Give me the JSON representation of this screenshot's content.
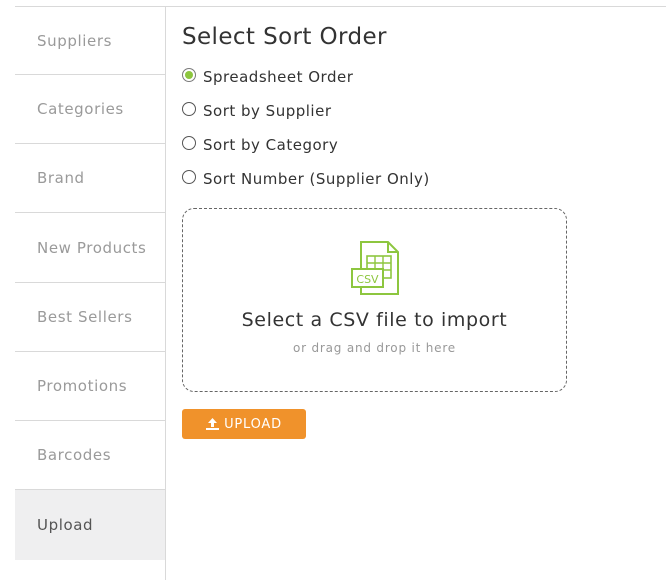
{
  "sidebar": {
    "items": [
      {
        "label": "Suppliers"
      },
      {
        "label": "Categories"
      },
      {
        "label": "Brand"
      },
      {
        "label": "New Products"
      },
      {
        "label": "Best Sellers"
      },
      {
        "label": "Promotions"
      },
      {
        "label": "Barcodes"
      },
      {
        "label": "Upload",
        "active": true
      }
    ]
  },
  "sort": {
    "title": "Select Sort Order",
    "options": [
      {
        "label": "Spreadsheet Order",
        "checked": true
      },
      {
        "label": "Sort by Supplier",
        "checked": false
      },
      {
        "label": "Sort by Category",
        "checked": false
      },
      {
        "label": "Sort Number (Supplier Only)",
        "checked": false
      }
    ]
  },
  "dropzone": {
    "icon": "csv-file-icon",
    "icon_text": "CSV",
    "title": "Select a CSV file to import",
    "subtitle": "or drag and drop it here"
  },
  "upload_button": {
    "label": "UPLOAD",
    "icon": "upload-icon"
  },
  "colors": {
    "accent_orange": "#f0922b",
    "accent_green": "#8dc63f",
    "sidebar_active_bg": "#efeff0"
  }
}
